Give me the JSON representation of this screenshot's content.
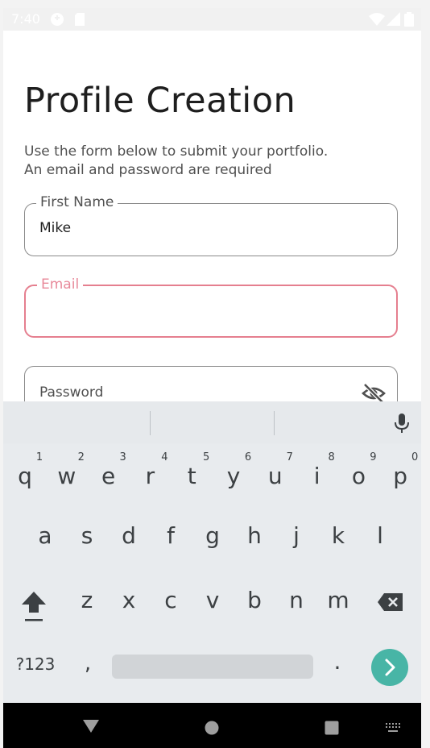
{
  "status_bar": {
    "time": "7:40",
    "icons": [
      "notification-icon",
      "sd-card-icon",
      "wifi-icon",
      "signal-icon",
      "battery-icon"
    ]
  },
  "page": {
    "title": "Profile Creation",
    "subtitle_line1": "Use the form below to submit your portfolio.",
    "subtitle_line2": "An email and password are required"
  },
  "form": {
    "first_name": {
      "label": "First Name",
      "value": "Mike"
    },
    "email": {
      "label": "Email",
      "value": ""
    },
    "password": {
      "placeholder": "Password",
      "icon": "eye-off-icon"
    }
  },
  "keyboard": {
    "row1": [
      {
        "k": "q",
        "h": "1"
      },
      {
        "k": "w",
        "h": "2"
      },
      {
        "k": "e",
        "h": "3"
      },
      {
        "k": "r",
        "h": "4"
      },
      {
        "k": "t",
        "h": "5"
      },
      {
        "k": "y",
        "h": "6"
      },
      {
        "k": "u",
        "h": "7"
      },
      {
        "k": "i",
        "h": "8"
      },
      {
        "k": "o",
        "h": "9"
      },
      {
        "k": "p",
        "h": "0"
      }
    ],
    "row2": [
      "a",
      "s",
      "d",
      "f",
      "g",
      "h",
      "j",
      "k",
      "l"
    ],
    "row3": [
      "z",
      "x",
      "c",
      "v",
      "b",
      "n",
      "m"
    ],
    "symbols_label": "?123",
    "comma": ",",
    "period": "."
  },
  "colors": {
    "accent_error": "#e57f8f",
    "enter_key": "#48b5a6"
  }
}
